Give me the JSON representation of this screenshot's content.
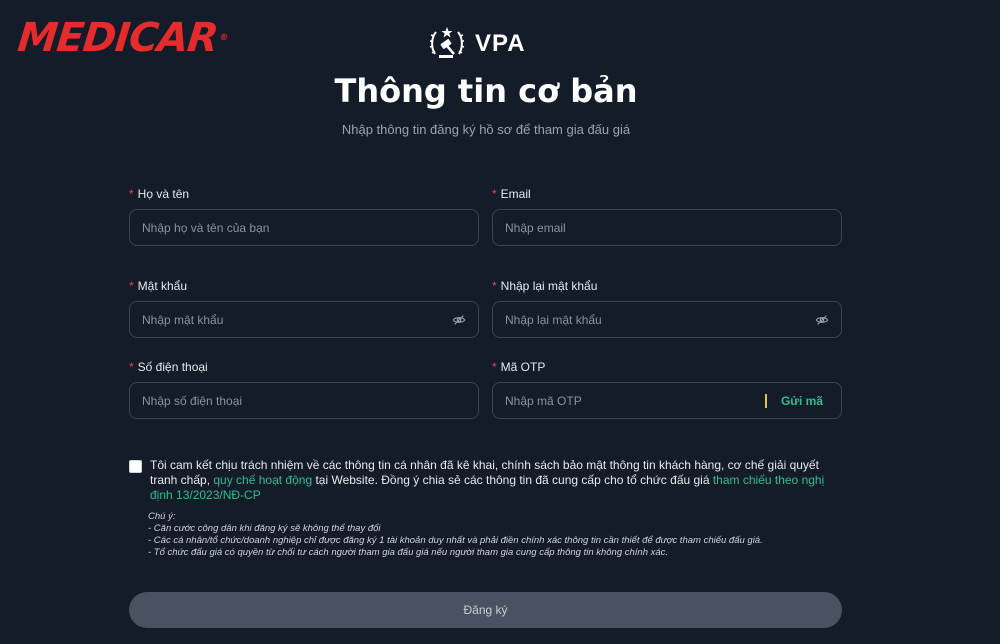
{
  "brand": {
    "logo_text": "MEDICAR",
    "registered": "®"
  },
  "org": {
    "name": "VPA"
  },
  "header": {
    "title": "Thông tin cơ bản",
    "subtitle": "Nhập thông tin đăng ký hồ sơ để tham gia đấu giá"
  },
  "form": {
    "required_mark": "*",
    "full_name": {
      "label": "Họ và tên",
      "placeholder": "Nhập họ và tên của bạn",
      "value": ""
    },
    "email": {
      "label": "Email",
      "placeholder": "Nhập email",
      "value": ""
    },
    "password": {
      "label": "Mật khẩu",
      "placeholder": "Nhập mật khẩu",
      "value": ""
    },
    "confirm_password": {
      "label": "Nhập lại mật khẩu",
      "placeholder": "Nhập lại mật khẩu",
      "value": ""
    },
    "phone": {
      "label": "Số điện thoại",
      "placeholder": "Nhập số điện thoại",
      "value": ""
    },
    "otp": {
      "label": "Mã OTP",
      "placeholder": "Nhập mã OTP",
      "value": "",
      "send_label": "Gửi mã"
    }
  },
  "consent": {
    "checked": false,
    "text_part1": "Tôi cam kết chịu trách nhiệm về các thông tin cá nhân đã kê khai, chính sách bảo mật thông tin khách hàng, cơ chế giải quyết tranh chấp, ",
    "link1": "quy chế hoạt động",
    "text_part2": " tại Website. Đồng ý chia sẻ các thông tin đã cung cấp cho tổ chức đấu giá ",
    "link2": "tham chiếu theo nghị định 13/2023/NĐ-CP"
  },
  "notes": {
    "title": "Chú ý:",
    "items": [
      "- Căn cước công dân khi đăng ký sẽ không thể thay đổi",
      "- Các cá nhân/tổ chức/doanh nghiệp chỉ được đăng ký 1 tài khoản duy nhất và phải điền chính xác thông tin cần thiết để được tham chiếu đấu giá.",
      "- Tổ chức đấu giá có quyền từ chối tư cách người tham gia đấu giá nếu người tham gia cung cấp thông tin không chính xác."
    ]
  },
  "submit": {
    "label": "Đăng ký"
  },
  "colors": {
    "background": "#141b29",
    "brand_red": "#e52b2b",
    "accent_green": "#2fbf8f",
    "required_red": "#e5484d"
  }
}
